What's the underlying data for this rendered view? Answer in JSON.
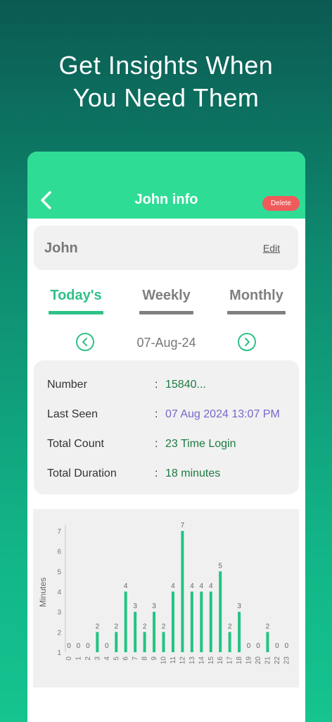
{
  "hero": {
    "line1": "Get Insights When",
    "line2": "You Need Them"
  },
  "header": {
    "title": "John info",
    "delete_label": "Delete",
    "back_icon": "chevron-left-icon"
  },
  "profile": {
    "name": "John",
    "edit_label": "Edit"
  },
  "tabs": [
    {
      "label": "Today's",
      "active": true
    },
    {
      "label": "Weekly",
      "active": false
    },
    {
      "label": "Monthly",
      "active": false
    }
  ],
  "date_nav": {
    "date": "07-Aug-24",
    "prev_icon": "chevron-left-circle-icon",
    "next_icon": "chevron-right-circle-icon"
  },
  "info": [
    {
      "label": "Number",
      "value": "15840..."
    },
    {
      "label": "Last Seen",
      "value": "07 Aug 2024 13:07 PM"
    },
    {
      "label": "Total Count",
      "value": "23 Time Login"
    },
    {
      "label": "Total Duration",
      "value": "18 minutes"
    }
  ],
  "colors": {
    "accent": "#2fdc96",
    "green_text": "#1e7a43",
    "purple_text": "#7a66c9",
    "delete": "#f05a5a"
  },
  "chart_data": {
    "type": "bar",
    "ylabel": "Minutes",
    "xlabel": "",
    "ylim": [
      1,
      7
    ],
    "yticks": [
      1,
      2,
      3,
      4,
      5,
      6,
      7
    ],
    "categories": [
      "0",
      "1",
      "2",
      "3",
      "4",
      "5",
      "6",
      "7",
      "8",
      "9",
      "10",
      "11",
      "12",
      "13",
      "14",
      "15",
      "16",
      "17",
      "18",
      "19",
      "20",
      "21",
      "22",
      "23"
    ],
    "values": [
      0,
      0,
      0,
      2,
      0,
      2,
      4,
      3,
      2,
      3,
      2,
      4,
      7,
      4,
      4,
      4,
      5,
      2,
      3,
      0,
      0,
      2,
      0,
      0
    ],
    "color": "#22c483"
  }
}
